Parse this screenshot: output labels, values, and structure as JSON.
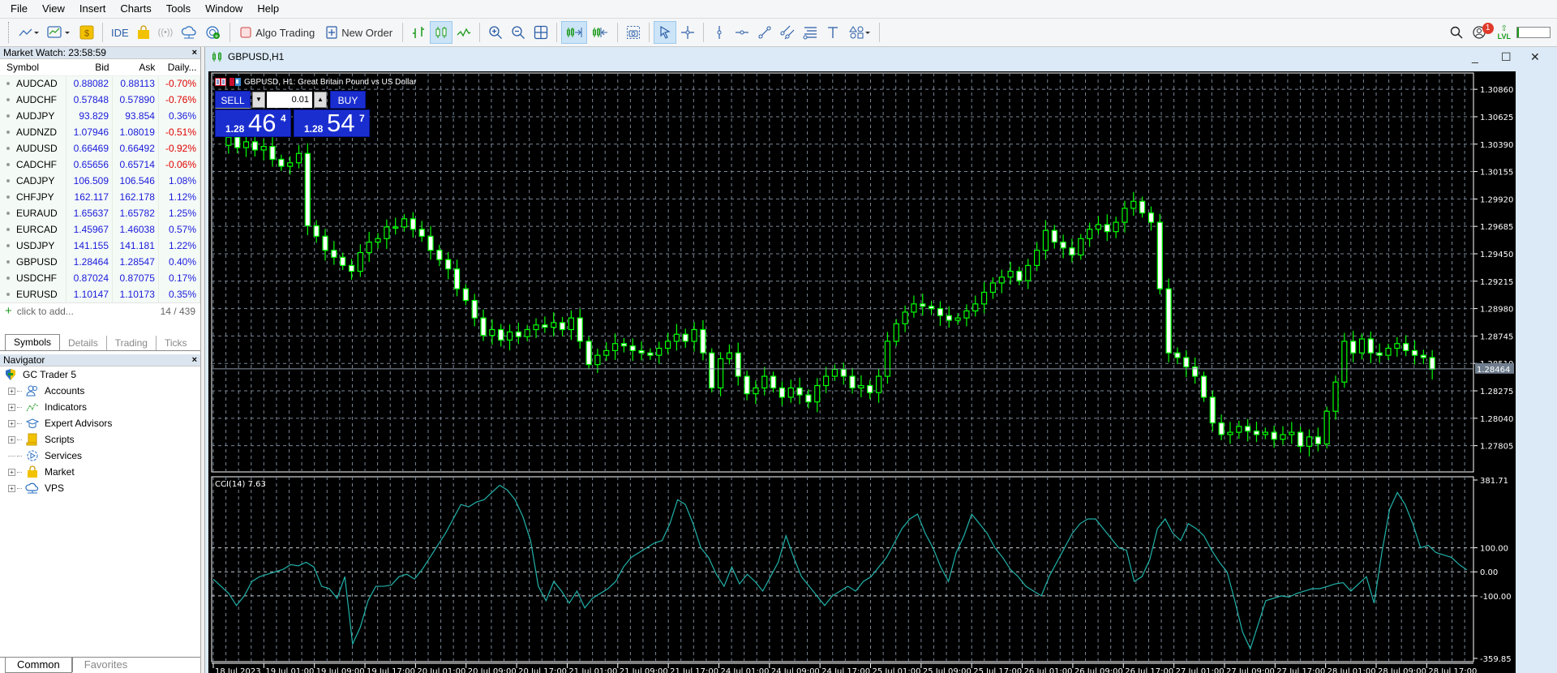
{
  "menu": [
    "File",
    "View",
    "Insert",
    "Charts",
    "Tools",
    "Window",
    "Help"
  ],
  "toolbar": {
    "ide": "IDE",
    "algo_trading": "Algo Trading",
    "new_order": "New Order",
    "notification_count": "1",
    "lvl": "LVL"
  },
  "market_watch": {
    "title": "Market Watch: 23:58:59",
    "columns": [
      "Symbol",
      "Bid",
      "Ask",
      "Daily..."
    ],
    "rows": [
      {
        "symbol": "AUDCAD",
        "bid": "0.88082",
        "ask": "0.88113",
        "daily": "-0.70%"
      },
      {
        "symbol": "AUDCHF",
        "bid": "0.57848",
        "ask": "0.57890",
        "daily": "-0.76%"
      },
      {
        "symbol": "AUDJPY",
        "bid": "93.829",
        "ask": "93.854",
        "daily": "0.36%"
      },
      {
        "symbol": "AUDNZD",
        "bid": "1.07946",
        "ask": "1.08019",
        "daily": "-0.51%"
      },
      {
        "symbol": "AUDUSD",
        "bid": "0.66469",
        "ask": "0.66492",
        "daily": "-0.92%"
      },
      {
        "symbol": "CADCHF",
        "bid": "0.65656",
        "ask": "0.65714",
        "daily": "-0.06%"
      },
      {
        "symbol": "CADJPY",
        "bid": "106.509",
        "ask": "106.546",
        "daily": "1.08%"
      },
      {
        "symbol": "CHFJPY",
        "bid": "162.117",
        "ask": "162.178",
        "daily": "1.12%"
      },
      {
        "symbol": "EURAUD",
        "bid": "1.65637",
        "ask": "1.65782",
        "daily": "1.25%"
      },
      {
        "symbol": "EURCAD",
        "bid": "1.45967",
        "ask": "1.46038",
        "daily": "0.57%"
      },
      {
        "symbol": "USDJPY",
        "bid": "141.155",
        "ask": "141.181",
        "daily": "1.22%"
      },
      {
        "symbol": "GBPUSD",
        "bid": "1.28464",
        "ask": "1.28547",
        "daily": "0.40%"
      },
      {
        "symbol": "USDCHF",
        "bid": "0.87024",
        "ask": "0.87075",
        "daily": "0.17%"
      },
      {
        "symbol": "EURUSD",
        "bid": "1.10147",
        "ask": "1.10173",
        "daily": "0.35%"
      }
    ],
    "add_label": "click to add...",
    "count": "14 / 439",
    "tabs": [
      "Symbols",
      "Details",
      "Trading",
      "Ticks"
    ]
  },
  "navigator": {
    "title": "Navigator",
    "root": "GC Trader 5",
    "items": [
      {
        "label": "Accounts",
        "icon": "accounts-icon"
      },
      {
        "label": "Indicators",
        "icon": "indicators-icon"
      },
      {
        "label": "Expert Advisors",
        "icon": "expert-advisors-icon"
      },
      {
        "label": "Scripts",
        "icon": "scripts-icon"
      },
      {
        "label": "Services",
        "icon": "services-icon"
      },
      {
        "label": "Market",
        "icon": "market-icon"
      },
      {
        "label": "VPS",
        "icon": "vps-icon"
      }
    ],
    "tabs": [
      "Common",
      "Favorites"
    ]
  },
  "chart": {
    "window_title": "GBPUSD,H1",
    "symbol_header": "GBPUSD, H1:  Great Britain Pound vs US Dollar",
    "sell_label": "SELL",
    "buy_label": "BUY",
    "volume": "0.01",
    "sell_price": {
      "prefix": "1.28",
      "big": "46",
      "sup": "4"
    },
    "buy_price": {
      "prefix": "1.28",
      "big": "54",
      "sup": "7"
    },
    "current_price": "1.28464",
    "indicator_label": "CCI(14) 7.63"
  },
  "chart_data": {
    "type": "candlestick",
    "price_axis": {
      "ticks": [
        "1.30860",
        "1.30625",
        "1.30390",
        "1.30155",
        "1.29920",
        "1.29685",
        "1.29450",
        "1.29215",
        "1.28980",
        "1.28745",
        "1.28510",
        "1.28275",
        "1.28040",
        "1.27805"
      ],
      "range": [
        1.2758,
        1.31
      ]
    },
    "time_axis": [
      "18 Jul 2023",
      "19 Jul 01:00",
      "19 Jul 09:00",
      "19 Jul 17:00",
      "20 Jul 01:00",
      "20 Jul 09:00",
      "20 Jul 17:00",
      "21 Jul 01:00",
      "21 Jul 09:00",
      "21 Jul 17:00",
      "24 Jul 01:00",
      "24 Jul 09:00",
      "24 Jul 17:00",
      "25 Jul 01:00",
      "25 Jul 09:00",
      "25 Jul 17:00",
      "26 Jul 01:00",
      "26 Jul 09:00",
      "26 Jul 17:00",
      "27 Jul 01:00",
      "27 Jul 09:00",
      "27 Jul 17:00",
      "28 Jul 01:00",
      "28 Jul 09:00",
      "28 Jul 17:00"
    ],
    "close_path": [
      1.3038,
      1.3045,
      1.3036,
      1.3041,
      1.3034,
      1.3037,
      1.3026,
      1.302,
      1.3023,
      1.3031,
      1.2969,
      1.296,
      1.2948,
      1.2942,
      1.2935,
      1.293,
      1.2946,
      1.2955,
      1.2958,
      1.2968,
      1.2968,
      1.2975,
      1.2966,
      1.296,
      1.2948,
      1.294,
      1.2932,
      1.2915,
      1.2905,
      1.289,
      1.2875,
      1.288,
      1.2871,
      1.2878,
      1.2874,
      1.288,
      1.2884,
      1.2882,
      1.2886,
      1.288,
      1.289,
      1.287,
      1.285,
      1.2858,
      1.2862,
      1.2868,
      1.2866,
      1.2862,
      1.286,
      1.2858,
      1.2864,
      1.287,
      1.2876,
      1.287,
      1.288,
      1.286,
      1.283,
      1.2855,
      1.286,
      1.284,
      1.2825,
      1.283,
      1.284,
      1.283,
      1.2822,
      1.283,
      1.2824,
      1.2818,
      1.2832,
      1.284,
      1.2846,
      1.284,
      1.283,
      1.2832,
      1.2826,
      1.284,
      1.287,
      1.2885,
      1.2895,
      1.2902,
      1.29,
      1.2898,
      1.2892,
      1.2888,
      1.289,
      1.2896,
      1.2902,
      1.2912,
      1.292,
      1.2925,
      1.293,
      1.2922,
      1.2935,
      1.2948,
      1.2965,
      1.2955,
      1.295,
      1.2944,
      1.2958,
      1.2966,
      1.297,
      1.2964,
      1.2972,
      1.2984,
      1.299,
      1.298,
      1.2972,
      1.2915,
      1.286,
      1.2856,
      1.2848,
      1.284,
      1.2822,
      1.28,
      1.279,
      1.2792,
      1.2797,
      1.2793,
      1.279,
      1.2792,
      1.2786,
      1.279,
      1.2792,
      1.278,
      1.2788,
      1.2782,
      1.281,
      1.2835,
      1.287,
      1.286,
      1.2872,
      1.286,
      1.2858,
      1.2864,
      1.2868,
      1.2862,
      1.2858,
      1.2856,
      1.2846
    ],
    "indicator": {
      "name": "CCI(14)",
      "value": 7.63,
      "levels": [
        100,
        0,
        -100
      ],
      "range": [
        -359.85,
        381.71
      ],
      "values": [
        -30,
        -60,
        -90,
        -140,
        -100,
        -40,
        -20,
        -10,
        0,
        10,
        30,
        25,
        40,
        20,
        -60,
        -70,
        -110,
        -20,
        -300,
        -230,
        -120,
        -60,
        -60,
        -55,
        -20,
        -10,
        -30,
        10,
        60,
        110,
        160,
        220,
        280,
        270,
        290,
        300,
        330,
        360,
        340,
        300,
        230,
        130,
        -60,
        -120,
        -40,
        -80,
        -130,
        -80,
        -150,
        -110,
        -90,
        -70,
        -40,
        20,
        60,
        80,
        100,
        120,
        130,
        200,
        300,
        280,
        200,
        100,
        60,
        -10,
        -60,
        20,
        -50,
        -10,
        -40,
        -80,
        -20,
        40,
        150,
        60,
        -20,
        -60,
        -100,
        -140,
        -100,
        -80,
        -60,
        -80,
        -40,
        -20,
        20,
        60,
        120,
        180,
        220,
        240,
        160,
        100,
        20,
        -40,
        80,
        150,
        240,
        200,
        160,
        100,
        60,
        10,
        -20,
        -60,
        -80,
        -100,
        -20,
        40,
        100,
        160,
        200,
        220,
        220,
        180,
        140,
        100,
        90,
        -40,
        -20,
        50,
        180,
        220,
        160,
        130,
        200,
        180,
        150,
        90,
        40,
        0,
        -120,
        -250,
        -320,
        -220,
        -120,
        -110,
        -100,
        -105,
        -90,
        -80,
        -70,
        -70,
        -60,
        -50,
        -45,
        -80,
        -50,
        -20,
        -130,
        80,
        260,
        330,
        280,
        200,
        100,
        110,
        80,
        70,
        60,
        30,
        8
      ]
    }
  }
}
